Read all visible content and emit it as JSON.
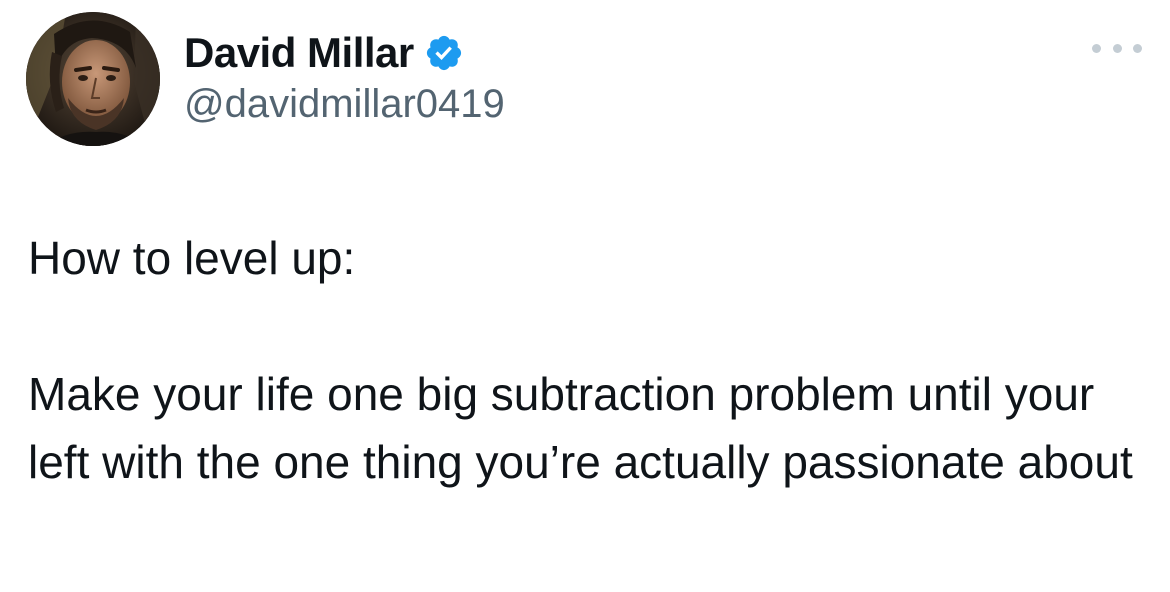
{
  "author": {
    "display_name": "David Millar",
    "handle": "@davidmillar0419",
    "verified": true
  },
  "icons": {
    "avatar": "profile-photo",
    "verified": "verified-badge-icon",
    "more": "more-options-icon"
  },
  "colors": {
    "text_primary": "#0f1419",
    "text_secondary": "#536471",
    "verified_blue": "#1d9bf0",
    "more_dots": "#c4cdd4",
    "background": "#ffffff"
  },
  "tweet": {
    "line1": "How to level up:",
    "line2": "Make your life one big subtraction problem until your left with the one thing you’re actually passionate about"
  }
}
